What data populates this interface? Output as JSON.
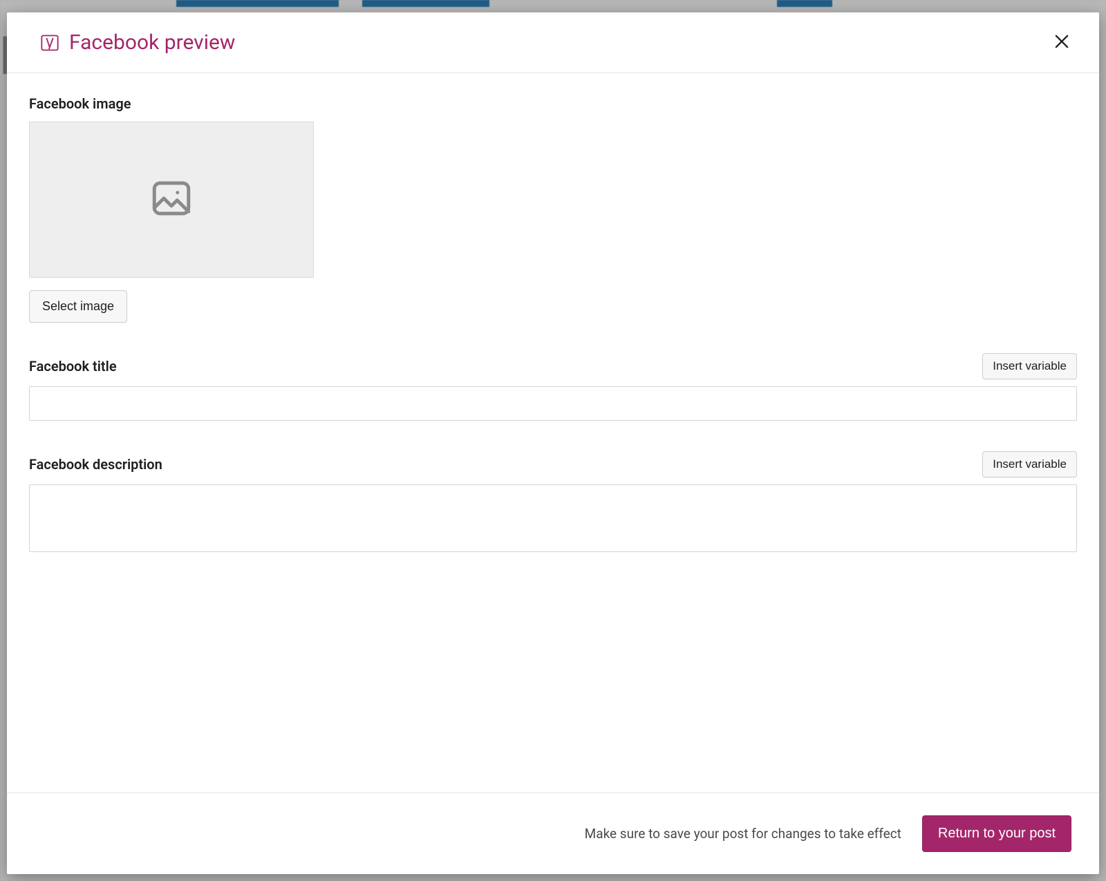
{
  "modal": {
    "title": "Facebook preview",
    "sections": {
      "image_label": "Facebook image",
      "select_image_btn": "Select image",
      "title_label": "Facebook title",
      "title_insert_btn": "Insert variable",
      "title_value": "",
      "desc_label": "Facebook description",
      "desc_insert_btn": "Insert variable",
      "desc_value": ""
    },
    "footer": {
      "note": "Make sure to save your post for changes to take effect",
      "return_btn": "Return to your post"
    }
  },
  "colors": {
    "brand": "#a4266a"
  }
}
